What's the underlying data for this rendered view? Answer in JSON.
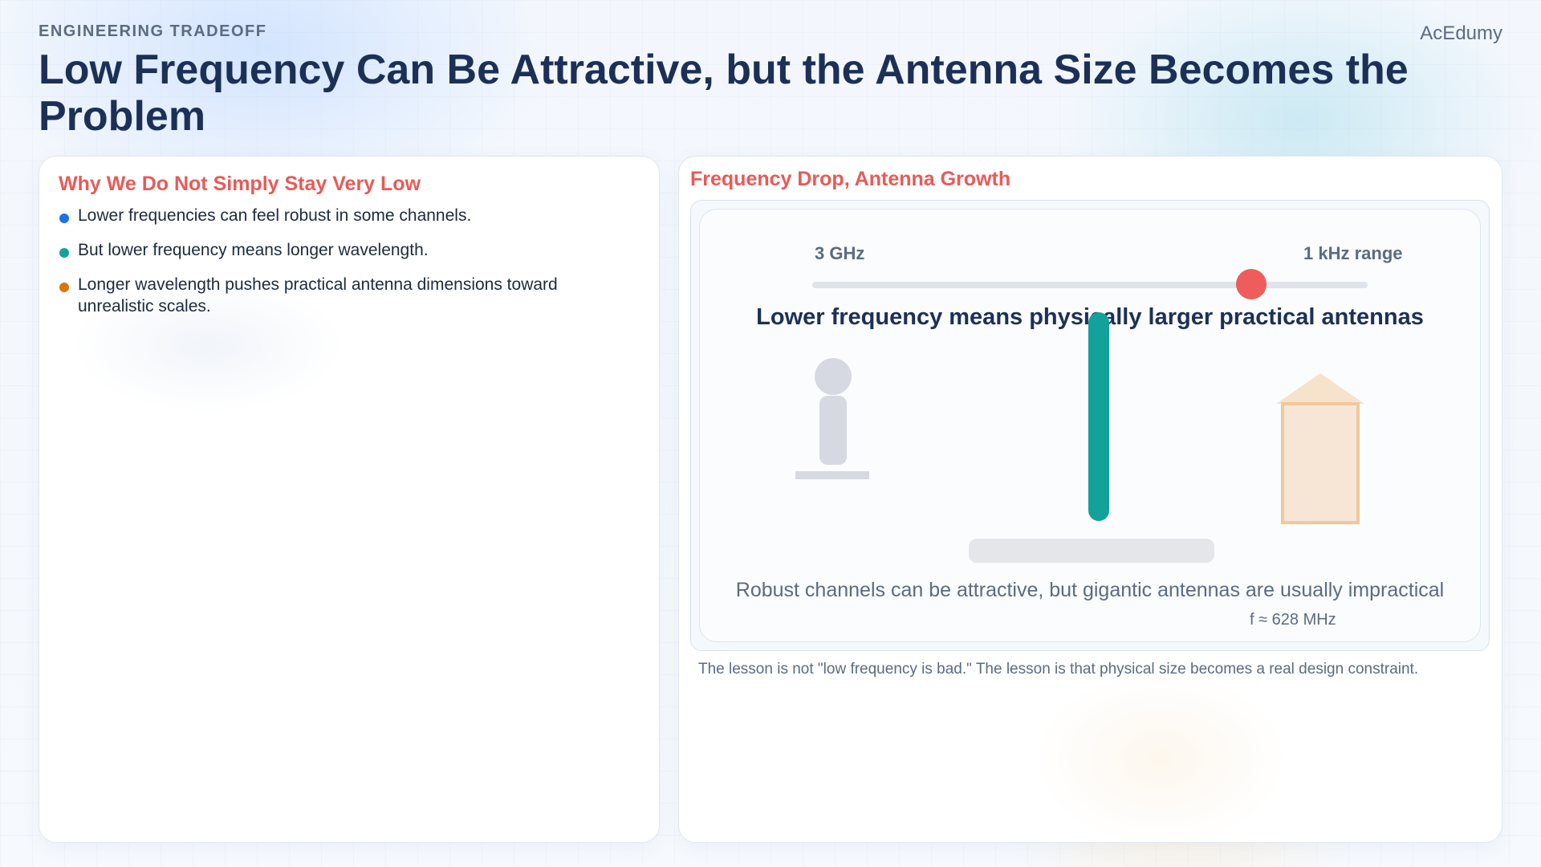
{
  "header": {
    "eyebrow": "ENGINEERING TRADEOFF",
    "title": "Low Frequency Can Be Attractive, but the Antenna Size Becomes the Problem",
    "brand": "AcEdumy"
  },
  "left_panel": {
    "heading": "Why We Do Not Simply Stay Very Low",
    "bullets": [
      {
        "text": "Lower frequencies can feel robust in some channels.",
        "color": "#1a73e8"
      },
      {
        "text": "But lower frequency means longer wavelength.",
        "color": "#13a19b"
      },
      {
        "text": "Longer wavelength pushes practical antenna dimensions toward unrealistic scales.",
        "color": "#d97706"
      }
    ]
  },
  "right_panel": {
    "heading": "Frequency Drop, Antenna Growth",
    "slider": {
      "left_label": "3 GHz",
      "right_label": "1 kHz range",
      "value_fraction": 0.79
    },
    "caption": "Lower frequency means physically larger practical antennas",
    "note": "Robust channels can be attractive, but gigantic antennas are usually impractical",
    "formula": "f ≈ 628 MHz",
    "lesson": "The lesson is not \"low frequency is bad.\" The lesson is that physical size becomes a real design constraint."
  },
  "colors": {
    "title": "#1c3057",
    "accent_red": "#e85a57",
    "antenna": "#13a19b",
    "slider_thumb": "#ee5c5c",
    "house_fill": "#f7e2cc",
    "house_stroke": "#f0c89a",
    "person": "#d6d9e1"
  }
}
